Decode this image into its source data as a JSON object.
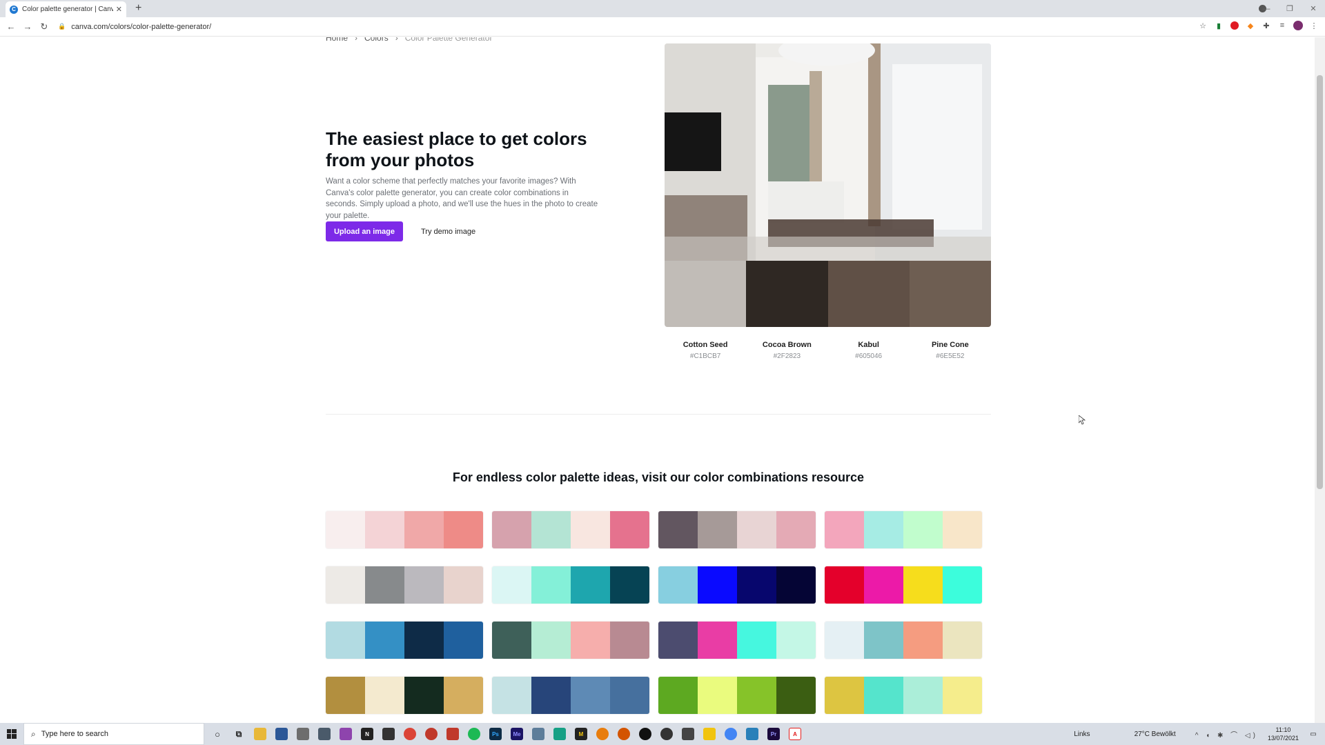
{
  "browser": {
    "tab_title": "Color palette generator | Canva",
    "tab_favicon_letter": "C",
    "url": "canva.com/colors/color-palette-generator/"
  },
  "breadcrumb": {
    "home": "Home",
    "colors": "Colors",
    "current": "Color Palette Generator"
  },
  "hero": {
    "title": "The easiest place to get colors from your photos",
    "description": "Want a color scheme that perfectly matches your favorite images? With Canva's color palette generator, you can create color combinations in seconds. Simply upload a photo, and we'll use the hues in the photo to create your palette.",
    "upload_label": "Upload an image",
    "demo_label": "Try demo image"
  },
  "extracted_palette": [
    {
      "name": "Cotton Seed",
      "hex": "#C1BCB7"
    },
    {
      "name": "Cocoa Brown",
      "hex": "#2F2823"
    },
    {
      "name": "Kabul",
      "hex": "#605046"
    },
    {
      "name": "Pine Cone",
      "hex": "#6E5E52"
    }
  ],
  "combinations": {
    "title": "For endless color palette ideas, visit our color combinations resource",
    "palettes": [
      [
        "#f8eeee",
        "#f4d3d6",
        "#f0a8a8",
        "#ee8b87"
      ],
      [
        "#d6a2ad",
        "#b4e4d4",
        "#f8e6e0",
        "#e5728e"
      ],
      [
        "#625660",
        "#a69a98",
        "#e8d4d4",
        "#e4aab5"
      ],
      [
        "#f3a6bc",
        "#a6ece4",
        "#c1fdcd",
        "#f8e6c9"
      ],
      [
        "#edeae6",
        "#878a8c",
        "#bbb9be",
        "#e8d3cd"
      ],
      [
        "#dbf6f4",
        "#84f0d8",
        "#1ea6ae",
        "#064354"
      ],
      [
        "#87cfe0",
        "#0a0aff",
        "#07066d",
        "#050535"
      ],
      [
        "#e4002b",
        "#ec1aa8",
        "#f6dd1c",
        "#3cfddc"
      ],
      [
        "#b2dbe2",
        "#3490c5",
        "#0e2b47",
        "#1f609e"
      ],
      [
        "#3e6059",
        "#b5edd4",
        "#f6aeac",
        "#b88a92"
      ],
      [
        "#4c4c6f",
        "#e93da5",
        "#46f7df",
        "#c4f7e6"
      ],
      [
        "#e5f0f4",
        "#7ec4c8",
        "#f59c80",
        "#ebe5bf"
      ],
      [
        "#b28f3f",
        "#f4eacf",
        "#142b1f",
        "#d5ae5f"
      ],
      [
        "#c5e2e4",
        "#27457a",
        "#5e8ab5",
        "#46709e"
      ],
      [
        "#5da921",
        "#eafb7e",
        "#86c329",
        "#3b5e12"
      ],
      [
        "#ddc541",
        "#55e4cc",
        "#abeed9",
        "#f5ed8c"
      ]
    ]
  },
  "taskbar": {
    "search_placeholder": "Type here to search",
    "links_label": "Links",
    "weather": "27°C  Bewölkt",
    "time": "11:10",
    "date": "13/07/2021"
  }
}
